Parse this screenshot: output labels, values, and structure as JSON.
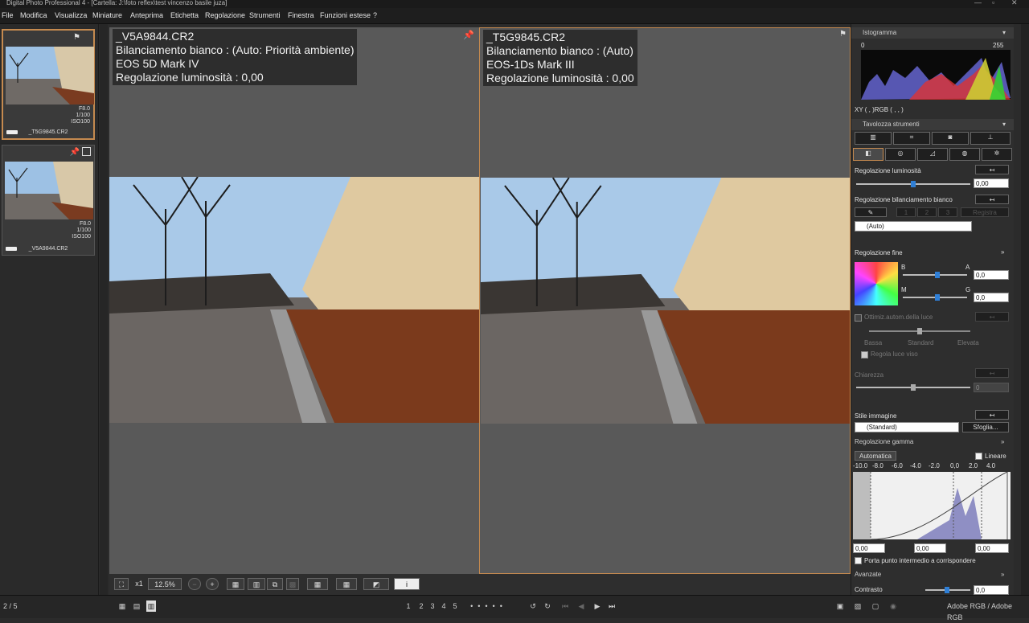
{
  "app": {
    "title": "Digital Photo Professional 4 - [Cartella: J:\\foto reflex\\test vincenzo basile juza]"
  },
  "menu": [
    "File",
    "Modifica",
    "Visualizza",
    "Miniature",
    "Anteprima",
    "Etichetta",
    "Regolazione",
    "Strumenti",
    "Finestra",
    "Funzioni estese",
    "?"
  ],
  "thumbnails": [
    {
      "name": "_T5G9845.CR2",
      "aperture": "F8.0",
      "shutter": "1/100",
      "iso": "ISO100"
    },
    {
      "name": "_V5A9844.CR2",
      "aperture": "F8.0",
      "shutter": "1/100",
      "iso": "ISO100"
    }
  ],
  "viewer": {
    "left": {
      "file": "_V5A9844.CR2",
      "wb": "Bilanciamento bianco : (Auto: Priorità ambiente)",
      "camera": "EOS 5D Mark IV",
      "brightness": "Regolazione luminosità : 0,00"
    },
    "right": {
      "file": "_T5G9845.CR2",
      "wb": "Bilanciamento bianco : (Auto)",
      "camera": "EOS-1Ds Mark III",
      "brightness": "Regolazione luminosità : 0,00"
    }
  },
  "toolbar": {
    "zoom_x1": "x1",
    "zoom_level": "12.5%"
  },
  "status": {
    "count": "2 / 5",
    "stars": [
      "1",
      "2",
      "3",
      "4",
      "5"
    ],
    "colorspace": "Adobe RGB / Adobe RGB"
  },
  "histogram": {
    "title": "Istogramma",
    "min": "0",
    "max": "255",
    "readout": "XY (    ,    )RGB (    ,    ,    )"
  },
  "tools": {
    "title": "Tavolozza strumenti",
    "brightness": {
      "label": "Regolazione luminosità",
      "value": "0,00"
    },
    "wb": {
      "label": "Regolazione bilanciamento bianco",
      "mode": "(Auto)",
      "buttons": [
        "1",
        "2",
        "3"
      ],
      "register": "Registra"
    },
    "fine": {
      "label": "Regolazione fine",
      "b": "B",
      "a": "A",
      "m": "M",
      "g": "G",
      "a_val": "0,0",
      "g_val": "0,0"
    },
    "alo": {
      "label": "Ottimiz.autom.della luce",
      "low": "Bassa",
      "std": "Standard",
      "high": "Elevata",
      "face": "Regola luce viso"
    },
    "sharp": {
      "label": "Chiarezza",
      "value": "0"
    },
    "style": {
      "label": "Stile immagine",
      "value": "(Standard)",
      "browse": "Sfoglia..."
    },
    "gamma": {
      "label": "Regolazione gamma",
      "auto": "Automatica",
      "linear": "Lineare",
      "ticks": [
        "-10.0",
        "-8.0",
        "-6.0",
        "-4.0",
        "-2.0",
        "0,0",
        "2.0",
        "4.0"
      ],
      "v1": "0,00",
      "v2": "0,00",
      "v3": "0,00",
      "mid": "Porta punto intermedio a corrispondere"
    },
    "advanced": {
      "label": "Avanzate",
      "contrast": "Contrasto",
      "contrast_val": "0,0"
    }
  }
}
